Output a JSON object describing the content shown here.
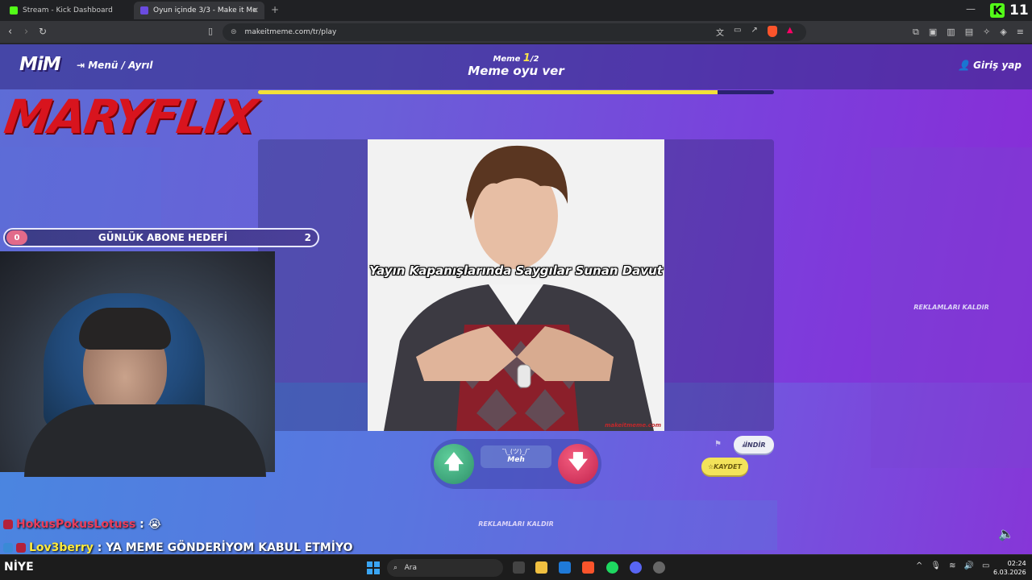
{
  "browser": {
    "tabs": [
      {
        "title": "Stream - Kick Dashboard",
        "active": false
      },
      {
        "title": "Oyun içinde 3/3 - Make it Me",
        "active": true
      }
    ],
    "url": "makeitmeme.com/tr/play",
    "kick_count": "11"
  },
  "header": {
    "logo": "MiM",
    "menu_label": "Menü / Ayrıl",
    "meme_prefix": "Meme ",
    "meme_current": "1",
    "meme_total": "/2",
    "title": "Meme oyu ver",
    "login_label": "Giriş yap"
  },
  "progress": {
    "fraction": 0.89,
    "color": "#f2e039"
  },
  "overlay": {
    "brand": "MARYFLIX",
    "goal": {
      "current": "0",
      "label": "GÜNLÜK ABONE HEDEFİ",
      "target": "2"
    }
  },
  "meme": {
    "caption": "Yayın Kapanışlarında Saygılar Sunan Davut",
    "watermark": "makeitmeme.com"
  },
  "vote": {
    "up_icon": "arrow-up-icon",
    "shrug": "¯\\_(ツ)_/¯",
    "meh_label": "Meh",
    "down_icon": "arrow-down-icon"
  },
  "actions": {
    "download_label": "İNDİR",
    "save_label": "KAYDET"
  },
  "ads": {
    "side_label": "REKLAMLARI KALDIR",
    "bottom_label": "REKLAMLARI KALDIR"
  },
  "chat": [
    {
      "user": "HokusPokusLotuss",
      "sep": " : ",
      "message": "😭"
    },
    {
      "user": "Lov3berry",
      "sep": " : ",
      "message": "YA MEME GÖNDERİYOM KABUL ETMİYO"
    }
  ],
  "taskbar": {
    "left_text": "NİYE",
    "search_placeholder": "Ara",
    "time": "02:24",
    "date": "6.03.2026"
  },
  "colors": {
    "accent_yellow": "#f2e039",
    "kick_green": "#53fc18",
    "brand_red": "#d8141e"
  }
}
